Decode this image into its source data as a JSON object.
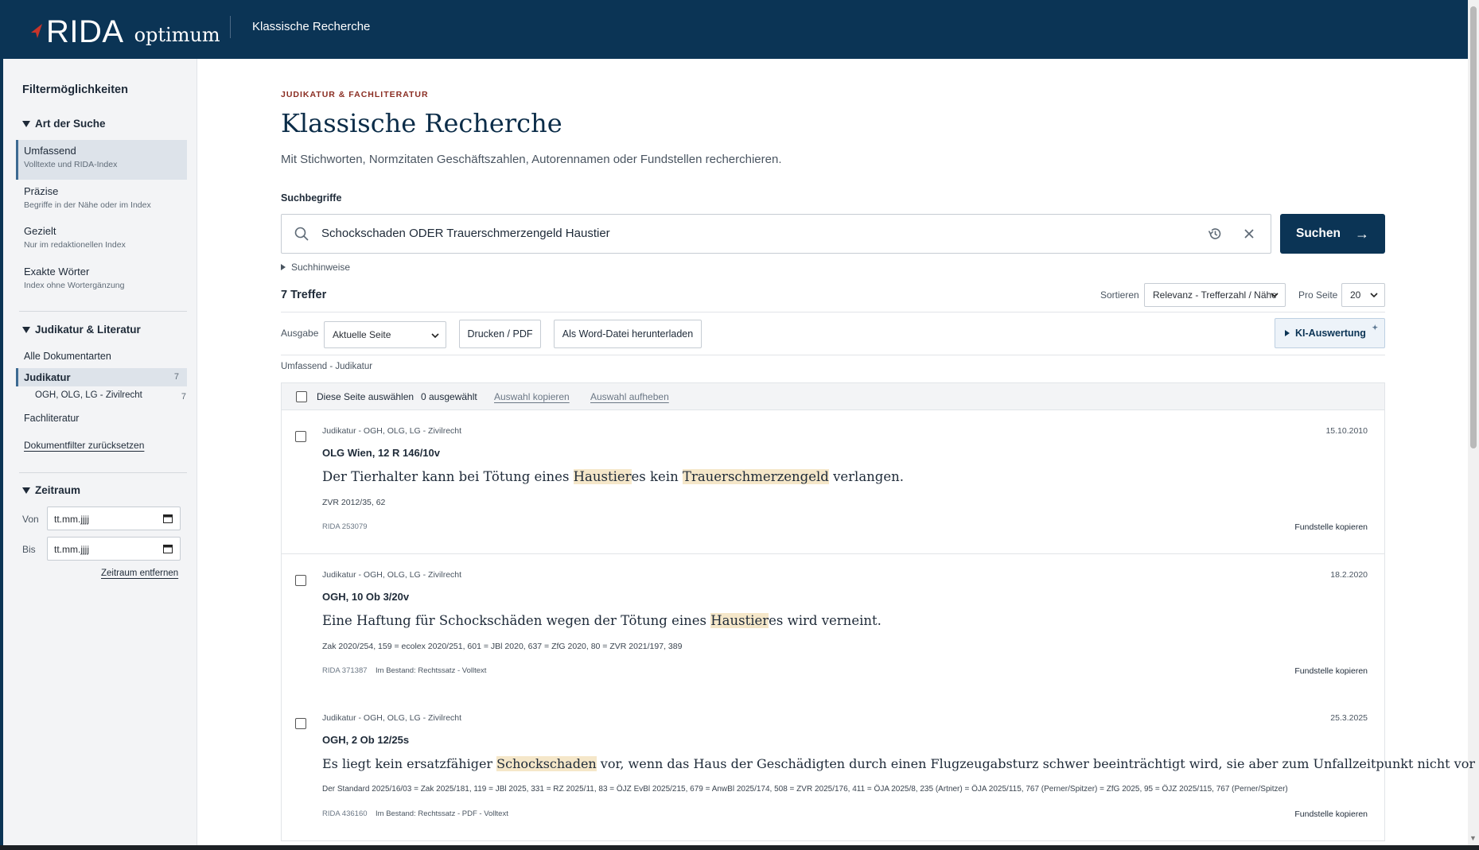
{
  "header": {
    "brand": "RIDA",
    "brand_suffix": "optimum",
    "section_title": "Klassische Recherche"
  },
  "sidebar": {
    "title": "Filtermöglichkeiten",
    "search_type": {
      "heading": "Art der Suche",
      "options": [
        {
          "label": "Umfassend",
          "sub": "Volltexte und RIDA-Index"
        },
        {
          "label": "Präzise",
          "sub": "Begriffe in der Nähe oder im Index"
        },
        {
          "label": "Gezielt",
          "sub": "Nur im redaktionellen Index"
        },
        {
          "label": "Exakte Wörter",
          "sub": "Index ohne Wortergänzung"
        }
      ]
    },
    "doc_types": {
      "heading": "Judikatur & Literatur",
      "all": "Alle Dokumentarten",
      "judikatur": "Judikatur",
      "judikatur_count": "7",
      "sub_court": "OGH, OLG, LG - Zivilrecht",
      "sub_court_count": "7",
      "fachliteratur": "Fachliteratur",
      "reset": "Dokumentfilter zurücksetzen"
    },
    "period": {
      "heading": "Zeitraum",
      "from_label": "Von",
      "to_label": "Bis",
      "placeholder": "tt.mm.jjjj",
      "remove": "Zeitraum entfernen"
    }
  },
  "main": {
    "kicker": "JUDIKATUR & FACHLITERATUR",
    "title": "Klassische Recherche",
    "lead": "Mit Stichworten, Normzitaten Geschäftszahlen, Autorennamen oder Fundstellen recherchieren.",
    "search_label": "Suchbegriffe",
    "search_value": "Schockschaden ODER Trauerschmerzengeld Haustier",
    "search_button": "Suchen",
    "search_hint": "Suchhinweise",
    "hits": "7 Treffer",
    "sort_label": "Sortieren",
    "sort_value": "Relevanz - Trefferzahl / Nähe",
    "per_page_label": "Pro Seite",
    "per_page_value": "20",
    "output_label": "Ausgabe",
    "output_value": "Aktuelle Seite",
    "print_button": "Drucken / PDF",
    "word_button": "Als Word-Datei herunterladen",
    "ki_button": "KI-Auswertung",
    "breadcrumb": "Umfassend - Judikatur",
    "select_page": "Diese Seite auswählen",
    "selected_count": "0 ausgewählt",
    "copy_selection": "Auswahl kopieren",
    "clear_selection": "Auswahl aufheben"
  },
  "results": [
    {
      "meta": "Judikatur - OGH, OLG, LG - Zivilrecht",
      "date": "15.10.2010",
      "title": "OLG Wien, 12 R 146/10v",
      "text": [
        {
          "t": "Der Tierhalter kann bei Tötung eines "
        },
        {
          "t": "Haustier",
          "hl": true
        },
        {
          "t": "es kein "
        },
        {
          "t": "Trauerschmerzengeld",
          "hl": true
        },
        {
          "t": " verlangen."
        }
      ],
      "cite": "ZVR 2012/35, 62",
      "rida_id": "RIDA 253079",
      "bestand": "",
      "copy": "Fundstelle kopieren"
    },
    {
      "meta": "Judikatur - OGH, OLG, LG - Zivilrecht",
      "date": "18.2.2020",
      "title": "OGH, 10 Ob 3/20v",
      "text": [
        {
          "t": "Eine Haftung für Schockschäden wegen der Tötung eines "
        },
        {
          "t": "Haustier",
          "hl": true
        },
        {
          "t": "es wird verneint."
        }
      ],
      "cite": "Zak 2020/254, 159 = ecolex 2020/251, 601 = JBl 2020, 637 = ZfG 2020, 80 = ZVR 2021/197, 389",
      "rida_id": "RIDA 371387",
      "bestand": "Im Bestand: Rechtssatz - Volltext",
      "copy": "Fundstelle kopieren"
    },
    {
      "meta": "Judikatur - OGH, OLG, LG - Zivilrecht",
      "date": "25.3.2025",
      "title": "OGH, 2 Ob 12/25s",
      "text": [
        {
          "t": "Es liegt kein ersatzfähiger "
        },
        {
          "t": "Schockschaden",
          "hl": true
        },
        {
          "t": " vor, wenn das Haus der Geschädigten durch einen Flugzeugabsturz schwer beeinträchtigt wird, sie aber zum Unfallzeitpunkt nicht vor Ort waren."
        }
      ],
      "cite": "Der Standard 2025/16/03 = Zak 2025/181, 119 = JBl 2025, 331 = RZ 2025/11, 83 = ÖJZ EvBl 2025/215, 679 = AnwBl 2025/174, 508 = ZVR 2025/176, 411 = ÖJA 2025/8, 235 (Artner) = ÖJA 2025/115, 767 (Perner/Spitzer) = ZfG 2025, 95 = ÖJZ 2025/115, 767 (Perner/Spitzer)",
      "rida_id": "RIDA 436160",
      "bestand": "Im Bestand: Rechtssatz - PDF - Volltext",
      "copy": "Fundstelle kopieren"
    }
  ]
}
